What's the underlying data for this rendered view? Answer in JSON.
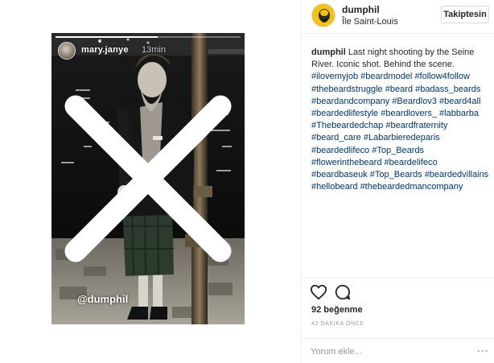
{
  "story": {
    "username": "mary.janye",
    "time": "13min",
    "mention": "@dumphil"
  },
  "header": {
    "username": "dumphil",
    "location": "Île Saint-Louis",
    "follow_label": "Takiptesin"
  },
  "caption": {
    "username": "dumphil",
    "text": "Last night shooting by the Seine River. Iconic shot. Behind the scene.",
    "hashtags": [
      "#ilovemyjob",
      "#beardmodel",
      "#follow4follow",
      "#thebeardstruggle",
      "#beard",
      "#badass_beards",
      "#beardandcompany",
      "#Beardlov3",
      "#beard4all",
      "#beardedlifestyle",
      "#beardlovers_",
      "#labbarba",
      "#Thebeardedchap",
      "#beardfraternity",
      "#beard_care",
      "#Labarbieredeparis",
      "#beardedlifeco",
      "#Top_Beards",
      "#flowerinthebeard",
      "#beardelifeco",
      "#beardbaseuk",
      "#Top_Beards",
      "#beardedvillains",
      "#hellobeard",
      "#thebeardedmancompany"
    ]
  },
  "actions": {
    "likes": "92 beğenme",
    "time_ago": "42 DAKİKA ÖNCE",
    "comment_placeholder": "Yorum ekle...",
    "more_label": "···"
  },
  "icons": {
    "like": "heart-icon",
    "comment": "comment-icon",
    "close": "close-icon",
    "more": "more-options-icon"
  },
  "colors": {
    "hashtag": "#003569",
    "border": "#efefef",
    "avatar_bg": "#f2c21b"
  }
}
